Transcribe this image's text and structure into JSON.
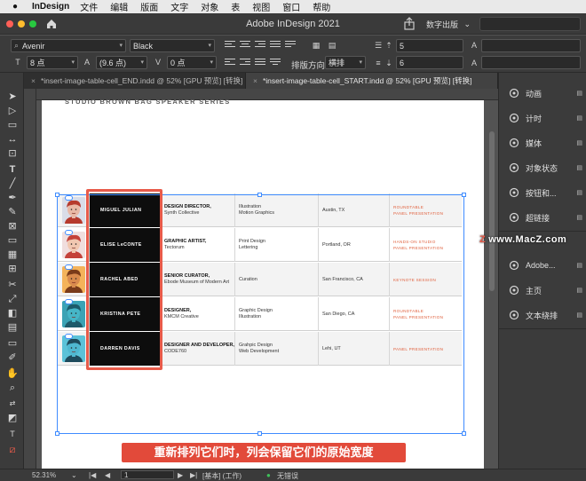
{
  "menubar": {
    "app_name": "InDesign",
    "items": [
      "文件",
      "编辑",
      "版面",
      "文字",
      "对象",
      "表",
      "视图",
      "窗口",
      "帮助"
    ]
  },
  "titlebar": {
    "title": "Adobe InDesign 2021",
    "workspace": "数字出版"
  },
  "control": {
    "font_family": "Avenir",
    "font_style": "Black",
    "font_size": "8 点",
    "leading": "(9.6 点)",
    "tracking": "0 点",
    "field_a": "5",
    "field_b": "6",
    "direction_label": "排版方向",
    "direction_value": "横排"
  },
  "tabs": [
    {
      "label": "*insert-image-table-cell_END.indd @ 52% [GPU 预览] [转换]",
      "active": false
    },
    {
      "label": "*insert-image-table-cell_START.indd @ 52% [GPU 预览] [转换]",
      "active": true
    }
  ],
  "document": {
    "header": "STUDIO BROWN BAG SPEAKER SERIES",
    "rows": [
      {
        "name": "MIGUEL JULIAN",
        "title_bold": "DESIGN DIRECTOR,",
        "title_rest": "Synth Collective",
        "field1": "Illustration",
        "field2": "Motion Graphics",
        "city": "Austin, TX",
        "session1": "ROUNDTABLE",
        "session2": "PANEL PRESENTATION",
        "skin": "#e9b9a6",
        "hair": "#b63a2d",
        "bg": "#d9dde8"
      },
      {
        "name": "ELISE LeCONTE",
        "title_bold": "GRAPHIC ARTIST,",
        "title_rest": "Tectorum",
        "field1": "Print Design",
        "field2": "Lettering",
        "city": "Portland, OR",
        "session1": "HANDS-ON STUDIO",
        "session2": "PANEL PRESENTATION",
        "skin": "#f1c7b0",
        "hair": "#c4423a",
        "bg": "#f0dede"
      },
      {
        "name": "RACHEL ABED",
        "title_bold": "SENIOR CURATOR,",
        "title_rest": "Ebode Museum of Modern Art",
        "field1": "Curation",
        "field2": "",
        "city": "San Francisco, CA",
        "session1": "KEYNOTE SESSION",
        "session2": "",
        "skin": "#d98a4d",
        "hair": "#7a3b1a",
        "bg": "#f4b35a"
      },
      {
        "name": "KRISTINA PETE",
        "title_bold": "DESIGNER,",
        "title_rest": "KMCM Creative",
        "field1": "Graphic Design",
        "field2": "Illustration",
        "city": "San Diego, CA",
        "session1": "ROUNDTABLE",
        "session2": "PANEL PRESENTATION",
        "skin": "#46b6c7",
        "hair": "#1d5a6a",
        "bg": "#3ba3b5"
      },
      {
        "name": "DARREN DAVIS",
        "title_bold": "DESIGNER AND DEVELOPER,",
        "title_rest": "CODE760",
        "field1": "Grahpic Design",
        "field2": "Web Development",
        "city": "Lehi, UT",
        "session1": "PANEL PRESENTATION",
        "session2": "",
        "skin": "#4fb7d0",
        "hair": "#1e4a5c",
        "bg": "#5bc2d8"
      }
    ]
  },
  "panels": [
    {
      "label": "动画",
      "icon": "animation-icon"
    },
    {
      "label": "计时",
      "icon": "timing-icon"
    },
    {
      "label": "媒体",
      "icon": "media-icon"
    },
    {
      "label": "对象状态",
      "icon": "object-states-icon"
    },
    {
      "label": "按钮和...",
      "icon": "buttons-icon"
    },
    {
      "label": "超链接",
      "icon": "hyperlinks-icon"
    },
    {
      "label": "Adobe...",
      "icon": "adobe-color-icon"
    },
    {
      "label": "主页",
      "icon": "pages-icon"
    },
    {
      "label": "文本绕排",
      "icon": "text-wrap-icon"
    }
  ],
  "watermark": "www.MacZ.com",
  "subtitle": "重新排列它们时，列会保留它们的原始宽度",
  "status": {
    "zoom": "52.31%",
    "page": "1",
    "mode": "[基本] (工作)",
    "errors": "无错误"
  },
  "colors": {
    "accent_red": "#e85b4a",
    "selection_blue": "#3f8cff",
    "session_orange": "#e0623f"
  }
}
